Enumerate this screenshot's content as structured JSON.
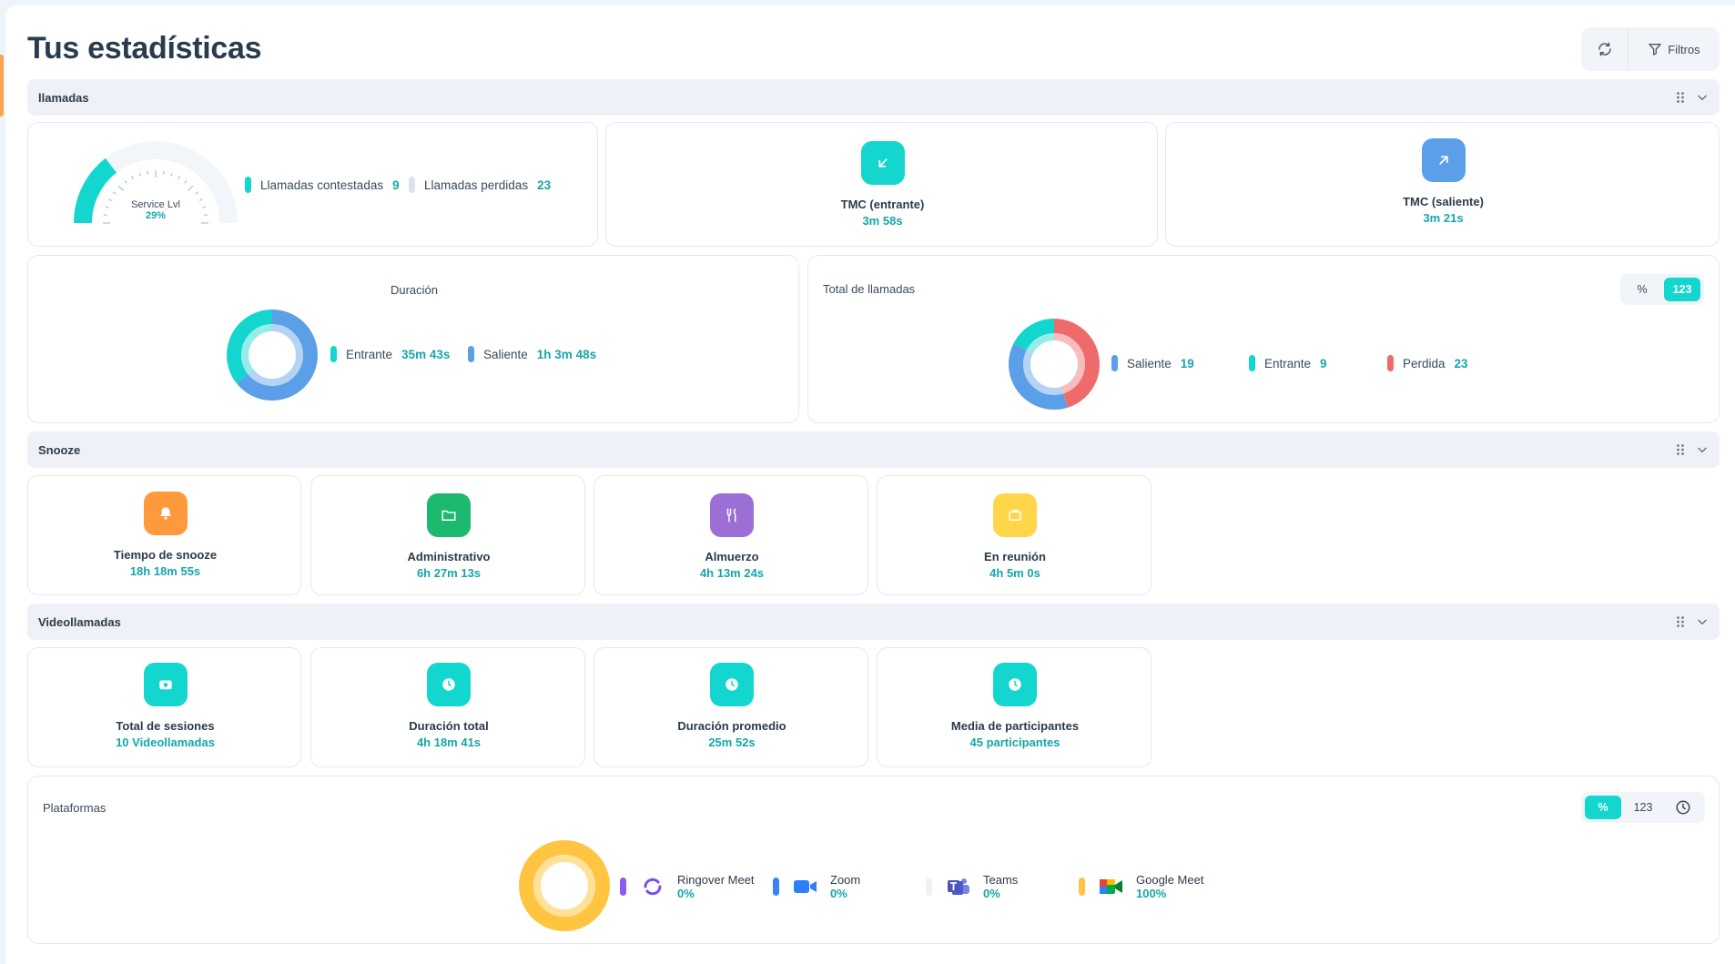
{
  "page": {
    "title": "Tus estadísticas"
  },
  "toolbar": {
    "filter_label": "Filtros"
  },
  "sections": {
    "calls": "llamadas",
    "snooze": "Snooze",
    "video": "Videollamadas"
  },
  "calls": {
    "service_level": {
      "label": "Service Lvl",
      "value": "29%",
      "fraction": 0.29
    },
    "answered": {
      "label": "Llamadas contestadas",
      "value": "9"
    },
    "missed": {
      "label": "Llamadas perdidas",
      "value": "23"
    },
    "tmc_in": {
      "label": "TMC (entrante)",
      "value": "3m 58s"
    },
    "tmc_out": {
      "label": "TMC (saliente)",
      "value": "3m 21s"
    },
    "duration": {
      "title": "Duración",
      "incoming": {
        "label": "Entrante",
        "value": "35m 43s",
        "seconds": 2143
      },
      "outgoing": {
        "label": "Saliente",
        "value": "1h 3m 48s",
        "seconds": 3828
      }
    },
    "total": {
      "title": "Total de llamadas",
      "toggle": [
        "%",
        "123"
      ],
      "outgoing": {
        "label": "Saliente",
        "value": "19",
        "count": 19
      },
      "incoming": {
        "label": "Entrante",
        "value": "9",
        "count": 9
      },
      "missed": {
        "label": "Perdida",
        "value": "23",
        "count": 23
      }
    }
  },
  "snooze": [
    {
      "label": "Tiempo de snooze",
      "value": "18h 18m 55s"
    },
    {
      "label": "Administrativo",
      "value": "6h 27m 13s"
    },
    {
      "label": "Almuerzo",
      "value": "4h 13m 24s"
    },
    {
      "label": "En reunión",
      "value": "4h 5m 0s"
    }
  ],
  "video": [
    {
      "label": "Total de sesiones",
      "value": "10 Videollamadas"
    },
    {
      "label": "Duración total",
      "value": "4h 18m 41s"
    },
    {
      "label": "Duración promedio",
      "value": "25m 52s"
    },
    {
      "label": "Media de participantes",
      "value": "45 participantes"
    }
  ],
  "platforms": {
    "title": "Plataformas",
    "toggle": [
      "%",
      "123"
    ],
    "items": [
      {
        "name": "Ringover Meet",
        "value": "0%"
      },
      {
        "name": "Zoom",
        "value": "0%"
      },
      {
        "name": "Teams",
        "value": "0%"
      },
      {
        "name": "Google Meet",
        "value": "100%"
      }
    ]
  },
  "colors": {
    "teal": "#13d6cf",
    "blue": "#5a9fe8",
    "red": "#ef6b6b",
    "orange": "#ff9a3c",
    "green": "#1cb96f",
    "purple": "#9b6fd6",
    "yellow": "#ffd54a",
    "value_text": "#16a6a8"
  }
}
